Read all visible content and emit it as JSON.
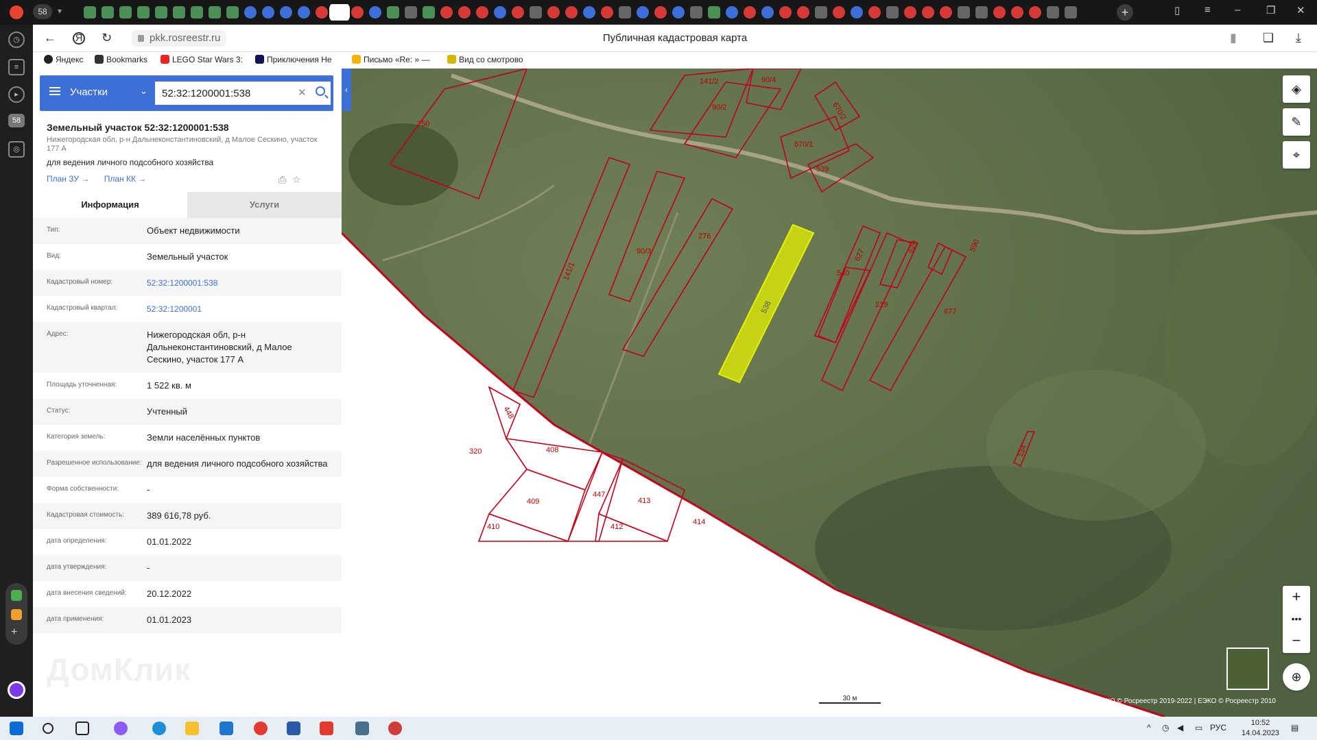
{
  "browser": {
    "tab_count": "58",
    "url": "pkk.rosreestr.ru",
    "page_title": "Публичная кадастровая карта",
    "bookmarks": [
      "Яндекс",
      "Bookmarks",
      "LEGO Star Wars 3:",
      "Приключения Не",
      "Письмо «Re: » —",
      "Вид со смотрово"
    ]
  },
  "sidebar": {
    "badge": "58"
  },
  "search": {
    "type": "Участки",
    "query": "52:32:1200001:538"
  },
  "object": {
    "title": "Земельный участок 52:32:1200001:538",
    "address": "Нижегородская обл, р-н Дальнеконстантиновский, д Малое Сескино, участок 177 А",
    "use": "для ведения личного подсобного хозяйства",
    "link_plan_zu": "План ЗУ →",
    "link_plan_kk": "План КК →"
  },
  "tabs": {
    "info": "Информация",
    "services": "Услуги"
  },
  "info_rows": [
    {
      "key": "Тип:",
      "value": "Объект недвижимости"
    },
    {
      "key": "Вид:",
      "value": "Земельный участок"
    },
    {
      "key": "Кадастровый номер:",
      "value": "52:32:1200001:538"
    },
    {
      "key": "Кадастровый квартал:",
      "value": "52:32:1200001"
    },
    {
      "key": "Адрес:",
      "value": "Нижегородская обл, р-н Дальнеконстантиновский, д Малое Сескино, участок 177 А"
    },
    {
      "key": "Площадь уточненная:",
      "value": "1 522 кв. м"
    },
    {
      "key": "Статус:",
      "value": "Учтенный"
    },
    {
      "key": "Категория земель:",
      "value": "Земли населённых пунктов"
    },
    {
      "key": "Разрешенное использование:",
      "value": "для ведения личного подсобного хозяйства"
    },
    {
      "key": "Форма собственности:",
      "value": "-"
    },
    {
      "key": "Кадастровая стоимость:",
      "value": "389 616,78 руб."
    },
    {
      "key": "дата определения:",
      "value": "01.01.2022"
    },
    {
      "key": "дата утверждения:",
      "value": "-"
    },
    {
      "key": "дата внесения сведений:",
      "value": "20.12.2022"
    },
    {
      "key": "дата применения:",
      "value": "01.01.2023"
    }
  ],
  "watermark": "ДомКлик",
  "map": {
    "parcel_labels": [
      "250",
      "141/2",
      "90/4",
      "90/2",
      "670/2",
      "670/1",
      "539",
      "141/1",
      "90/3",
      "276",
      "538",
      "627",
      "540",
      "219",
      "629",
      "590",
      "677",
      "448",
      "320",
      "408",
      "409",
      "410",
      "447",
      "413",
      "412",
      "414",
      "134"
    ],
    "scale_label": "30 м",
    "copyright": "ПКК © Росреестр 2010-2023 | ЕЭКО © Росреестр 2019-2022 | ЕЭКО © Росреестр 2010",
    "colors": {
      "parcel_outline": "#c0001a",
      "selected_fill": "#e6f000",
      "ui_accent": "#3d6fd6"
    }
  },
  "taskbar": {
    "language": "РУС",
    "time": "10:52",
    "date": "14.04.2023"
  }
}
